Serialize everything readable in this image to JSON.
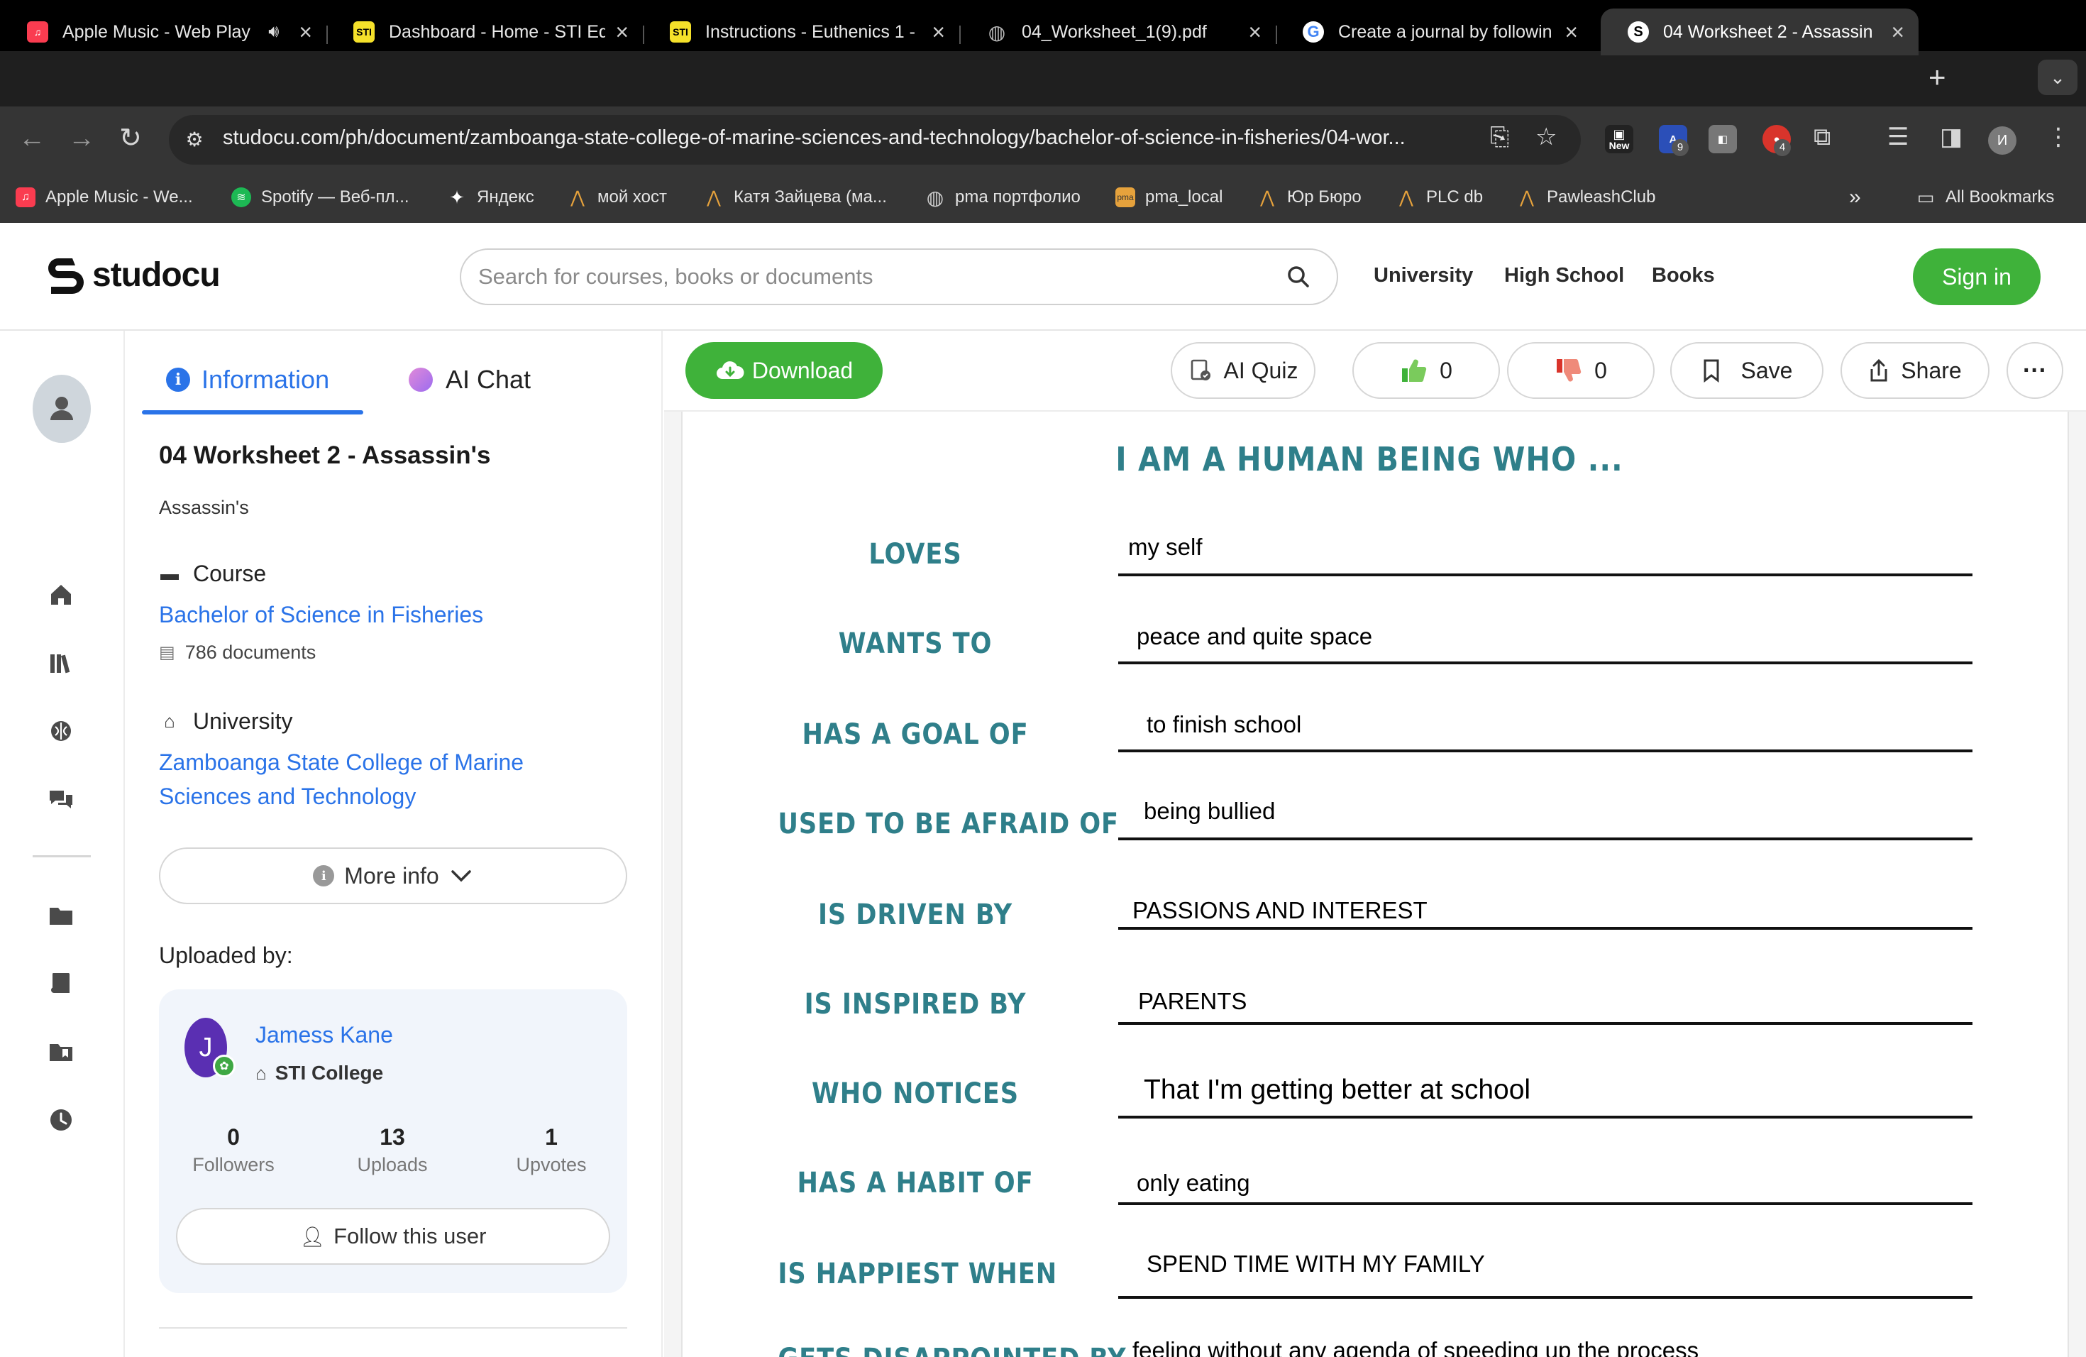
{
  "browser": {
    "tabs": [
      {
        "title": "Apple Music - Web Play",
        "icon": "apple-music-icon",
        "color": "#fa3c50",
        "audio": true
      },
      {
        "title": "Dashboard - Home - STI Ed",
        "icon": "sti-icon",
        "color": "#f5e12a"
      },
      {
        "title": "Instructions - Euthenics 1 -",
        "icon": "sti-icon",
        "color": "#f5e12a"
      },
      {
        "title": "04_Worksheet_1(9).pdf",
        "icon": "globe-icon",
        "color": "#bbbbbb"
      },
      {
        "title": "Create a journal by followin",
        "icon": "google-icon",
        "color": "#ffffff"
      },
      {
        "title": "04 Worksheet 2 - Assassin",
        "icon": "studocu-icon",
        "color": "#ffffff",
        "active": true
      }
    ],
    "sti_glyph": "STI",
    "url": "studocu.com/ph/document/zamboanga-state-college-of-marine-sciences-and-technology/bachelor-of-science-in-fisheries/04-wor...",
    "extensions": {
      "new_label": "New",
      "badge_a": "9",
      "badge_b": "4"
    },
    "profile_initial": "И",
    "bookmarks": [
      {
        "label": "Apple Music - We...",
        "icon": "apple-music-icon"
      },
      {
        "label": "Spotify — Веб-пл...",
        "icon": "spotify-icon"
      },
      {
        "label": "Яндекс",
        "icon": "yandex-icon"
      },
      {
        "label": "мой хост",
        "icon": "arch-icon"
      },
      {
        "label": "Катя Зайцева (ма...",
        "icon": "arch-icon"
      },
      {
        "label": "pma портфолио",
        "icon": "globe-icon"
      },
      {
        "label": "pma_local",
        "icon": "pma-icon"
      },
      {
        "label": "Юр Бюро",
        "icon": "arch-icon"
      },
      {
        "label": "PLC db",
        "icon": "arch-icon"
      },
      {
        "label": "PawleashClub",
        "icon": "arch-icon"
      }
    ],
    "all_bookmarks": "All Bookmarks",
    "overflow": "»"
  },
  "header": {
    "logo_text": "studocu",
    "search_placeholder": "Search for courses, books or documents",
    "nav": [
      "University",
      "High School",
      "Books"
    ],
    "signin": "Sign in"
  },
  "panel": {
    "tabs": {
      "information": "Information",
      "ai_chat": "AI Chat"
    },
    "info_glyph": "i",
    "title": "04 Worksheet 2 - Assassin's",
    "subtitle": "Assassin's",
    "course_label": "Course",
    "course_link": "Bachelor of Science in Fisheries",
    "docs_count": "786 documents",
    "university_label": "University",
    "university_link_1": "Zamboanga State College of Marine",
    "university_link_2": "Sciences and Technology",
    "more_info": "More info",
    "uploaded_by": "Uploaded by:",
    "user": {
      "initial": "J",
      "name": "Jamess Kane",
      "school": "STI College",
      "stats": [
        {
          "value": "0",
          "label": "Followers"
        },
        {
          "value": "13",
          "label": "Uploads"
        },
        {
          "value": "1",
          "label": "Upvotes"
        }
      ],
      "follow": "Follow this user"
    }
  },
  "doc_toolbar": {
    "download": "Download",
    "ai_quiz": "AI Quiz",
    "likes": "0",
    "dislikes": "0",
    "save": "Save",
    "share": "Share"
  },
  "worksheet": {
    "heading": "I AM A HUMAN BEING WHO ...",
    "rows": [
      {
        "label": "LOVES",
        "answer": "my self"
      },
      {
        "label": "WANTS TO",
        "answer": "peace and quite space"
      },
      {
        "label": "HAS A GOAL OF",
        "answer": "to finish school"
      },
      {
        "label": "USED TO BE AFRAID OF",
        "answer": "being bullied"
      },
      {
        "label": "IS DRIVEN BY",
        "answer": "PASSIONS AND INTEREST"
      },
      {
        "label": "IS INSPIRED BY",
        "answer": "PARENTS"
      },
      {
        "label": "WHO NOTICES",
        "answer": "That I'm getting better at school"
      },
      {
        "label": "HAS A HABIT OF",
        "answer": "only eating"
      },
      {
        "label": "IS HAPPIEST WHEN",
        "answer": "SPEND TIME WITH MY FAMILY"
      },
      {
        "label": "GETS DISAPPOINTED BY",
        "answer": "feeling without any agenda of speeding up the process"
      }
    ]
  },
  "colors": {
    "brand_green": "#3fb23a",
    "link_blue": "#2a73e8",
    "worksheet_teal": "#2f7f8a"
  }
}
